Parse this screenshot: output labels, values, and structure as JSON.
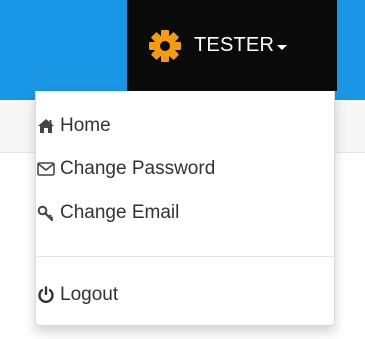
{
  "navbar": {
    "username": "TESTER",
    "accent_color": "#1a96e6",
    "gear_color": "#f39c12",
    "icons": {
      "gear": "gear-icon",
      "caret": "caret-down-icon"
    }
  },
  "dropdown": {
    "items": [
      {
        "label": "Home",
        "icon": "home-icon"
      },
      {
        "label": "Change Password",
        "icon": "envelope-icon"
      },
      {
        "label": "Change Email",
        "icon": "key-icon"
      }
    ],
    "logout": {
      "label": "Logout",
      "icon": "power-icon"
    }
  }
}
